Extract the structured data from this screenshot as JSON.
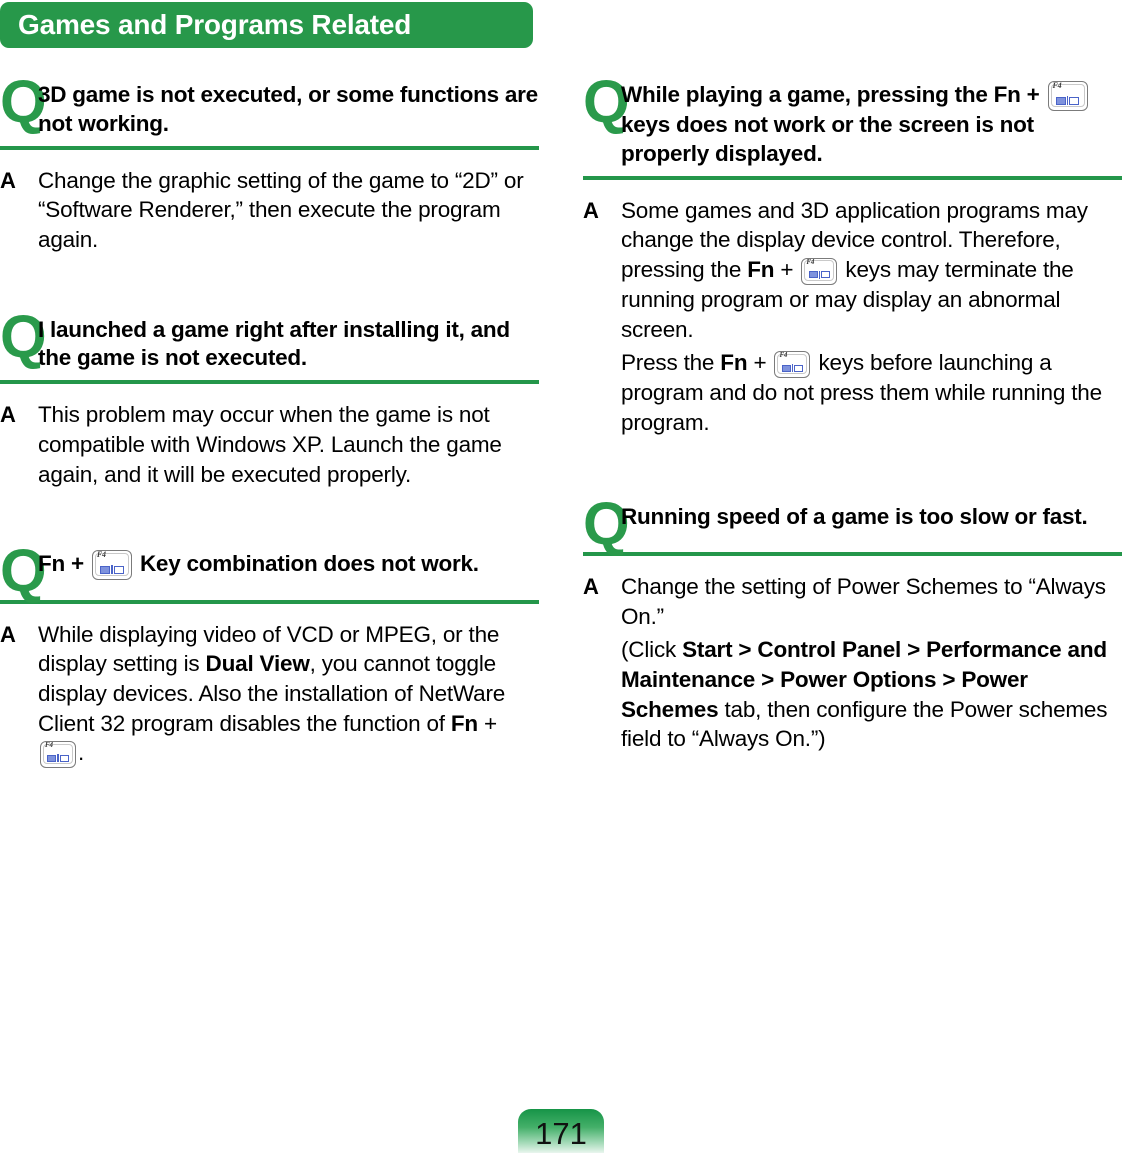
{
  "header": {
    "title": "Games and Programs Related"
  },
  "markers": {
    "question": "Q",
    "answer": "A"
  },
  "fkey": {
    "label": "F4",
    "icon_name": "display-toggle-key-icon"
  },
  "left_column": [
    {
      "question": "3D game is not executed, or some functions are not working.",
      "answer_paragraphs": [
        "Change the graphic setting of the game to “2D” or “Software Renderer,” then execute the program again."
      ]
    },
    {
      "question": "I launched a game right after installing it, and the game is not executed.",
      "answer_paragraphs": [
        "This problem may occur when the game is not compatible with Windows XP. Launch the game again, and it will be executed properly."
      ]
    },
    {
      "question_parts": {
        "fn": "Fn",
        "plus": "+",
        "tail": "Key combination does not work."
      },
      "answer_parts": {
        "p1_a": "While displaying video of VCD or MPEG, or the display setting is ",
        "p1_bold1": "Dual View",
        "p1_b": ", you cannot toggle display devices. Also the installation of NetWare Client 32 program disables the function of ",
        "p1_bold2": "Fn",
        "p1_c": " + ",
        "p1_d": "."
      }
    }
  ],
  "right_column": [
    {
      "question_parts": {
        "lead": "While playing a game, pressing the ",
        "fn": "Fn",
        "plus": " + ",
        "tail": " keys does not work or the screen is not properly displayed."
      },
      "answer_parts": {
        "p1_a": "Some games and 3D application programs may change the display device control. Therefore, pressing the ",
        "p1_fn": "Fn",
        "p1_b": " + ",
        "p1_c": " keys may terminate the running program or may display an abnormal screen.",
        "p2_a": "Press the ",
        "p2_fn": "Fn",
        "p2_b": " + ",
        "p2_c": " keys before launching a program and do not press them while running the program."
      }
    },
    {
      "question": "Running speed of a game is too slow or fast.",
      "answer_parts": {
        "p1": "Change the setting of Power Schemes to “Always On.”",
        "p2_a": "(Click ",
        "p2_bold": "Start > Control Panel > Performance and Maintenance > Power Options > Power Schemes",
        "p2_b": " tab, then configure the Power schemes field to “Always On.”)"
      }
    }
  ],
  "footer": {
    "page_number": "171"
  },
  "colors": {
    "brand_green": "#27984a",
    "divider_green": "#24964a",
    "q_green": "#2a9a4b",
    "key_blue": "#4a63c8"
  }
}
